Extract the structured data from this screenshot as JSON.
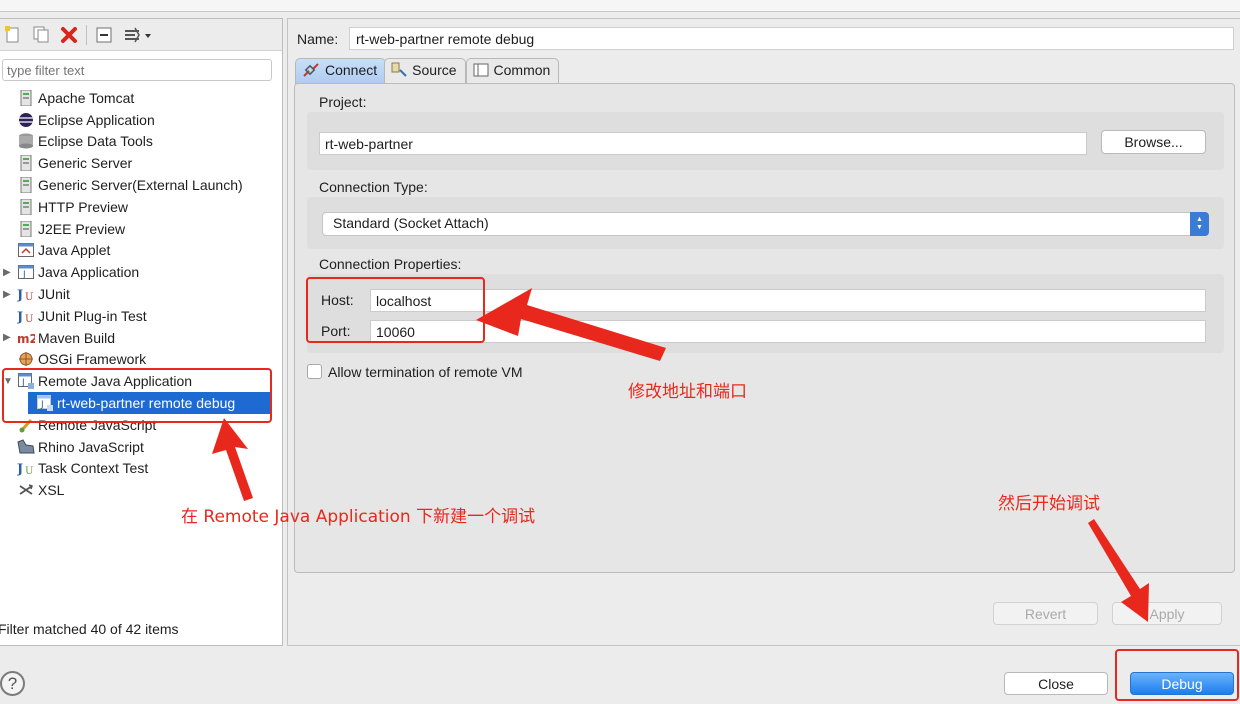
{
  "toolbar": {
    "icons": [
      "new-config-icon",
      "duplicate-icon",
      "delete-icon",
      "collapse-all-icon",
      "filter-icon"
    ]
  },
  "filter": {
    "placeholder": "type filter text"
  },
  "tree": {
    "items": [
      {
        "label": "Apache Tomcat",
        "icon": "server-icon"
      },
      {
        "label": "Eclipse Application",
        "icon": "eclipse-icon"
      },
      {
        "label": "Eclipse Data Tools",
        "icon": "database-icon"
      },
      {
        "label": "Generic Server",
        "icon": "server-icon"
      },
      {
        "label": "Generic Server(External Launch)",
        "icon": "server-icon"
      },
      {
        "label": "HTTP Preview",
        "icon": "server-icon"
      },
      {
        "label": "J2EE Preview",
        "icon": "server-icon"
      },
      {
        "label": "Java Applet",
        "icon": "applet-icon"
      },
      {
        "label": "Java Application",
        "icon": "java-app-icon"
      },
      {
        "label": "JUnit",
        "icon": "junit-icon"
      },
      {
        "label": "JUnit Plug-in Test",
        "icon": "junit-plugin-icon"
      },
      {
        "label": "Maven Build",
        "icon": "maven-icon"
      },
      {
        "label": "OSGi Framework",
        "icon": "osgi-icon"
      },
      {
        "label": "Remote Java Application",
        "icon": "remote-java-icon"
      },
      {
        "label": "rt-web-partner remote debug",
        "icon": "remote-debug-icon"
      },
      {
        "label": "Remote JavaScript",
        "icon": "remote-js-icon"
      },
      {
        "label": "Rhino JavaScript",
        "icon": "rhino-icon"
      },
      {
        "label": "Task Context Test",
        "icon": "task-icon"
      },
      {
        "label": "XSL",
        "icon": "xsl-icon"
      }
    ],
    "status": "Filter matched 40 of 42 items"
  },
  "config": {
    "name_label": "Name:",
    "name_value": "rt-web-partner remote debug",
    "tabs": [
      {
        "label": "Connect",
        "icon": "connect-icon"
      },
      {
        "label": "Source",
        "icon": "source-icon"
      },
      {
        "label": "Common",
        "icon": "common-icon"
      }
    ],
    "project_label": "Project:",
    "project_value": "rt-web-partner",
    "browse_label": "Browse...",
    "connection_type_label": "Connection Type:",
    "connection_type_value": "Standard (Socket Attach)",
    "connection_props_label": "Connection Properties:",
    "host_label": "Host:",
    "host_value": "localhost",
    "port_label": "Port:",
    "port_value": "10060",
    "allow_termination_label": "Allow termination of remote VM",
    "revert_label": "Revert",
    "apply_label": "Apply"
  },
  "footer": {
    "help_glyph": "?",
    "close_label": "Close",
    "debug_label": "Debug"
  },
  "annotations": {
    "modify_host_port": "修改地址和端口",
    "create_under_remote": "在 Remote Java Application 下新建一个调试",
    "then_start_debug": "然后开始调试"
  },
  "colors": {
    "annotation_red": "#e8281d",
    "selection_blue": "#1e6ad3",
    "primary_button": "#1a7ef0"
  }
}
